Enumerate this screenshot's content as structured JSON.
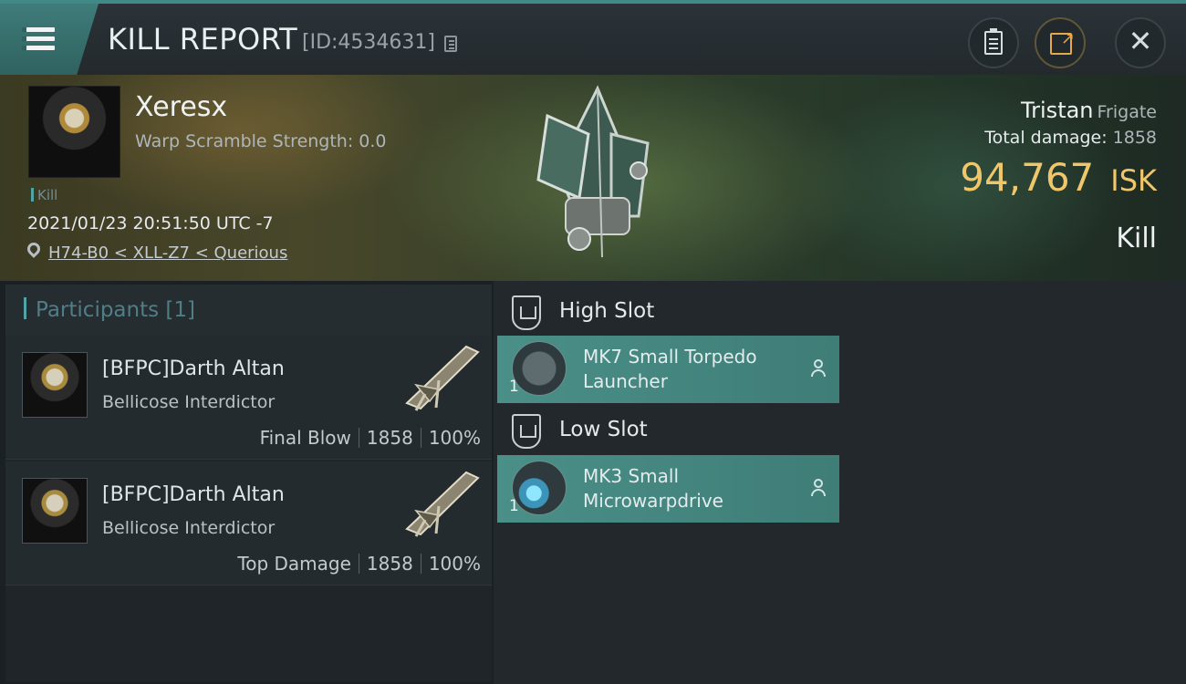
{
  "header": {
    "title": "KILL REPORT",
    "report_id": "[ID:4534631]"
  },
  "victim": {
    "pilot_name": "Xeresx",
    "warp_scramble": "Warp Scramble Strength: 0.0",
    "tag": "Kill",
    "datetime": "2021/01/23 20:51:50 UTC -7",
    "location": "H74-B0 < XLL-Z7 < Querious",
    "ship_name": "Tristan",
    "ship_class": "Frigate",
    "total_damage_label": "Total damage:",
    "total_damage": "1858",
    "isk_value": "94,767",
    "isk_unit": "ISK",
    "result": "Kill"
  },
  "participants": {
    "title": "Participants [1]",
    "rows": [
      {
        "name": "[BFPC]Darth Altan",
        "ship": "Bellicose Interdictor",
        "role": "Final Blow",
        "damage": "1858",
        "percent": "100%"
      },
      {
        "name": "[BFPC]Darth Altan",
        "ship": "Bellicose Interdictor",
        "role": "Top Damage",
        "damage": "1858",
        "percent": "100%"
      }
    ]
  },
  "fitting": {
    "high_slot": {
      "title": "High Slot",
      "module": {
        "name": "MK7 Small Torpedo Launcher",
        "qty": "1"
      }
    },
    "low_slot": {
      "title": "Low Slot",
      "module": {
        "name": "MK3 Small Microwarpdrive",
        "qty": "1"
      }
    }
  },
  "colors": {
    "accent_teal": "#4a8f88",
    "isk_gold": "#f0c66a",
    "header_teal": "#3f7c7a"
  },
  "icons": [
    "menu-icon",
    "copy-icon",
    "clipboard-icon",
    "share-icon",
    "close-icon",
    "location-pin-icon",
    "slot-shield-icon",
    "user-icon"
  ]
}
